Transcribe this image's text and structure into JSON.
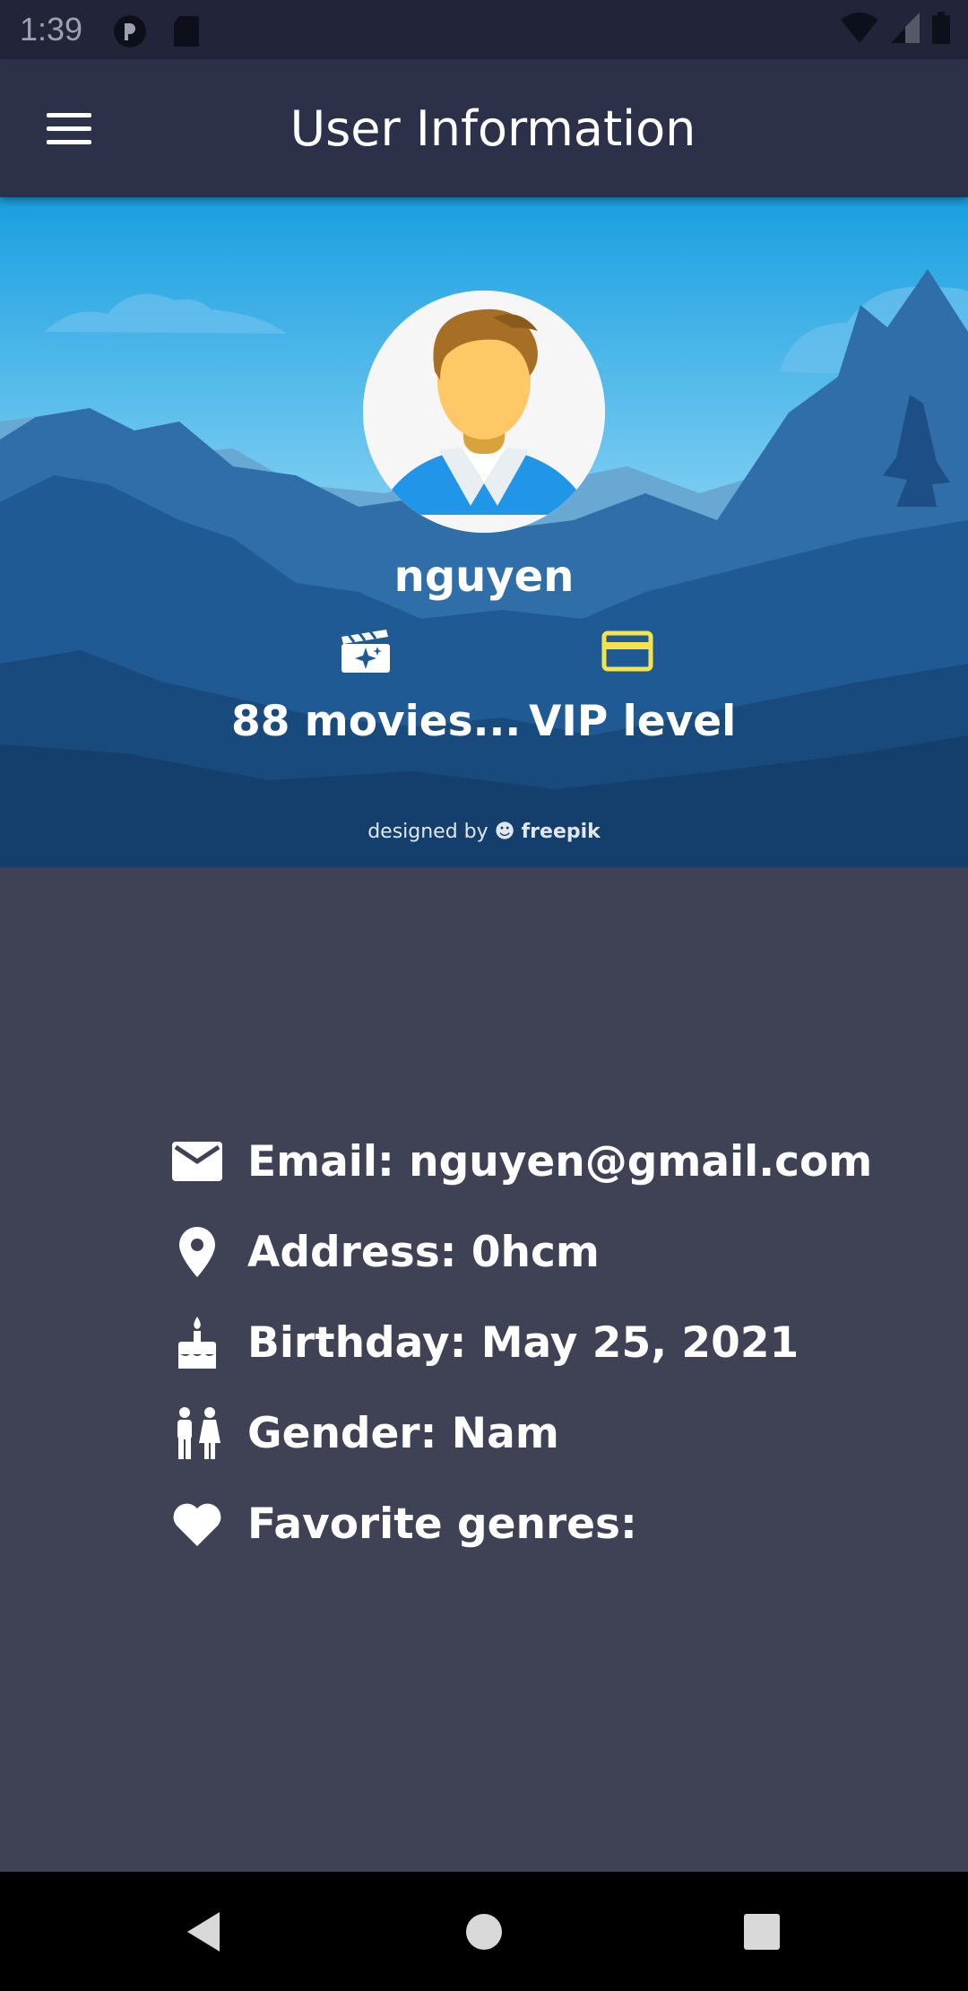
{
  "status_bar": {
    "time": "1:39"
  },
  "app_bar": {
    "title": "User Information"
  },
  "profile": {
    "username": "nguyen",
    "stats": [
      {
        "label": "88 movies...",
        "icon": "movie-star-icon",
        "color": "#ffffff"
      },
      {
        "label": "VIP level",
        "icon": "credit-card-icon",
        "color": "#f5e34b"
      }
    ],
    "credit": {
      "prefix": "designed by",
      "brand": "freepik"
    }
  },
  "info": {
    "email": "Email: nguyen@gmail.com",
    "address": "Address: 0hcm",
    "birthday": "Birthday: May 25, 2021",
    "gender": "Gender: Nam",
    "favorite_genres": "Favorite genres:"
  },
  "colors": {
    "app_bar": "#2d3049",
    "content_bg": "#3f4154",
    "vip_accent": "#f5e34b"
  }
}
